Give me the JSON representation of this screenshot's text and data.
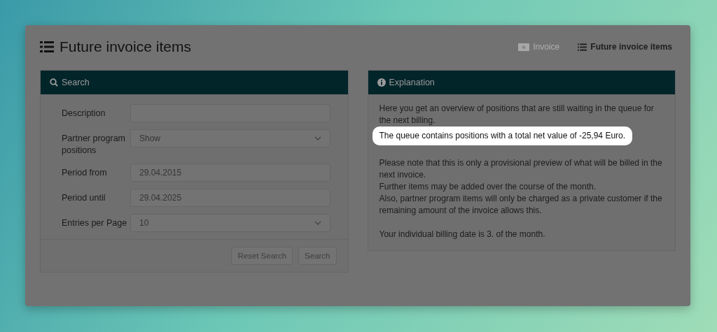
{
  "page": {
    "title": "Future invoice items"
  },
  "nav": [
    {
      "label": "Invoice",
      "selected": false
    },
    {
      "label": "Future invoice items",
      "selected": true
    }
  ],
  "search_panel": {
    "title": "Search",
    "fields": [
      {
        "label": "Description",
        "kind": "text"
      },
      {
        "label": "Partner program positions",
        "kind": "select",
        "value": "Show"
      },
      {
        "label": "Period from",
        "kind": "text",
        "value": "29.04.2015"
      },
      {
        "label": "Period until",
        "kind": "text",
        "value": "29.04.2025"
      },
      {
        "label": "Entries per Page",
        "kind": "select",
        "value": "10"
      }
    ],
    "buttons": [
      "Reset Search",
      "Search"
    ]
  },
  "explanation_panel": {
    "title": "Explanation",
    "paragraphs": [
      {
        "lines": [
          {
            "text": "Here you get an overview of positions that are still waiting in the queue for the next billing.",
            "highlighted": false
          },
          {
            "text": "The queue contains positions with a total net value of -25,94 Euro.",
            "highlighted": true
          }
        ]
      },
      {
        "lines": [
          {
            "text": "Please note that this is only a provisional preview of what will be billed in the next invoice.",
            "highlighted": false
          },
          {
            "text": "Further items may be added over the course of the month.",
            "highlighted": false
          },
          {
            "text": "Also, partner program items will only be charged as a private customer if the remaining amount of the invoice allows this.",
            "highlighted": false
          }
        ]
      },
      {
        "lines": [
          {
            "text": "Your individual billing date is 3. of the month.",
            "highlighted": false
          }
        ]
      }
    ]
  }
}
